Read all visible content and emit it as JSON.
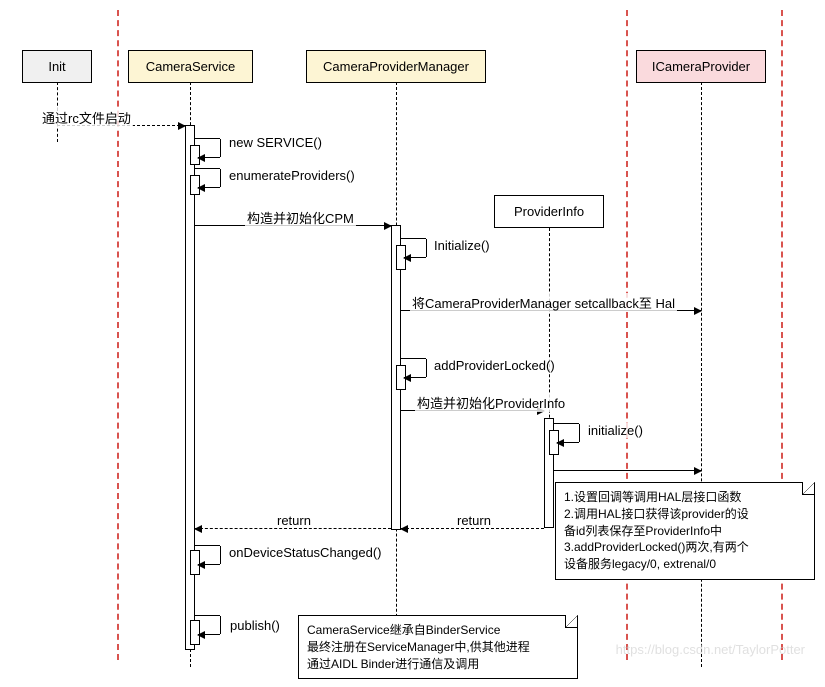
{
  "participants": {
    "init": "Init",
    "cs": "CameraService",
    "cpm": "CameraProviderManager",
    "pi": "ProviderInfo",
    "icp": "ICameraProvider"
  },
  "messages": {
    "start": "通过rc文件启动",
    "new_service": "new SERVICE()",
    "enum_providers": "enumerateProviders()",
    "init_cpm": "构造并初始化CPM",
    "initialize": "Initialize()",
    "set_callback": "将CameraProviderManager setcallback至 Hal",
    "add_provider": "addProviderLocked()",
    "init_pi": "构造并初始化ProviderInfo",
    "initialize2": "initialize()",
    "return1": "return",
    "return2": "return",
    "on_status": "onDeviceStatusChanged()",
    "publish": "publish()"
  },
  "notes": {
    "n1_l1": "1.设置回调等调用HAL层接口函数",
    "n1_l2": "2.调用HAL接口获得该provider的设",
    "n1_l3": "备id列表保存至ProviderInfo中",
    "n1_l4": "3.addProviderLocked()两次,有两个",
    "n1_l5": "设备服务legacy/0, extrenal/0",
    "n2_l1": "CameraService继承自BinderService",
    "n2_l2": "最终注册在ServiceManager中,供其他进程",
    "n2_l3": "通过AIDL Binder进行通信及调用"
  },
  "watermark": "https://blog.csdn.net/TaylorPotter"
}
